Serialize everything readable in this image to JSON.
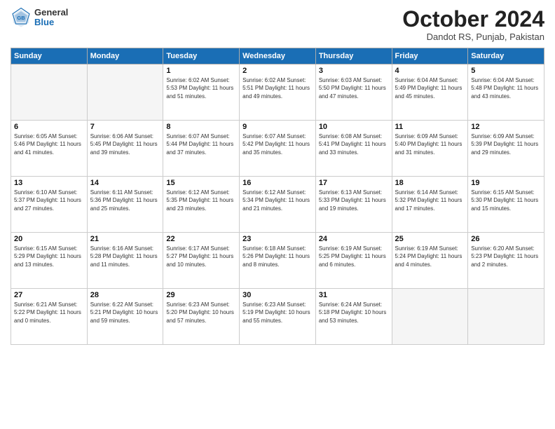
{
  "header": {
    "logo_general": "General",
    "logo_blue": "Blue",
    "month_title": "October 2024",
    "location": "Dandot RS, Punjab, Pakistan"
  },
  "days_of_week": [
    "Sunday",
    "Monday",
    "Tuesday",
    "Wednesday",
    "Thursday",
    "Friday",
    "Saturday"
  ],
  "weeks": [
    [
      {
        "day": "",
        "info": ""
      },
      {
        "day": "",
        "info": ""
      },
      {
        "day": "1",
        "info": "Sunrise: 6:02 AM\nSunset: 5:53 PM\nDaylight: 11 hours and 51 minutes."
      },
      {
        "day": "2",
        "info": "Sunrise: 6:02 AM\nSunset: 5:51 PM\nDaylight: 11 hours and 49 minutes."
      },
      {
        "day": "3",
        "info": "Sunrise: 6:03 AM\nSunset: 5:50 PM\nDaylight: 11 hours and 47 minutes."
      },
      {
        "day": "4",
        "info": "Sunrise: 6:04 AM\nSunset: 5:49 PM\nDaylight: 11 hours and 45 minutes."
      },
      {
        "day": "5",
        "info": "Sunrise: 6:04 AM\nSunset: 5:48 PM\nDaylight: 11 hours and 43 minutes."
      }
    ],
    [
      {
        "day": "6",
        "info": "Sunrise: 6:05 AM\nSunset: 5:46 PM\nDaylight: 11 hours and 41 minutes."
      },
      {
        "day": "7",
        "info": "Sunrise: 6:06 AM\nSunset: 5:45 PM\nDaylight: 11 hours and 39 minutes."
      },
      {
        "day": "8",
        "info": "Sunrise: 6:07 AM\nSunset: 5:44 PM\nDaylight: 11 hours and 37 minutes."
      },
      {
        "day": "9",
        "info": "Sunrise: 6:07 AM\nSunset: 5:42 PM\nDaylight: 11 hours and 35 minutes."
      },
      {
        "day": "10",
        "info": "Sunrise: 6:08 AM\nSunset: 5:41 PM\nDaylight: 11 hours and 33 minutes."
      },
      {
        "day": "11",
        "info": "Sunrise: 6:09 AM\nSunset: 5:40 PM\nDaylight: 11 hours and 31 minutes."
      },
      {
        "day": "12",
        "info": "Sunrise: 6:09 AM\nSunset: 5:39 PM\nDaylight: 11 hours and 29 minutes."
      }
    ],
    [
      {
        "day": "13",
        "info": "Sunrise: 6:10 AM\nSunset: 5:37 PM\nDaylight: 11 hours and 27 minutes."
      },
      {
        "day": "14",
        "info": "Sunrise: 6:11 AM\nSunset: 5:36 PM\nDaylight: 11 hours and 25 minutes."
      },
      {
        "day": "15",
        "info": "Sunrise: 6:12 AM\nSunset: 5:35 PM\nDaylight: 11 hours and 23 minutes."
      },
      {
        "day": "16",
        "info": "Sunrise: 6:12 AM\nSunset: 5:34 PM\nDaylight: 11 hours and 21 minutes."
      },
      {
        "day": "17",
        "info": "Sunrise: 6:13 AM\nSunset: 5:33 PM\nDaylight: 11 hours and 19 minutes."
      },
      {
        "day": "18",
        "info": "Sunrise: 6:14 AM\nSunset: 5:32 PM\nDaylight: 11 hours and 17 minutes."
      },
      {
        "day": "19",
        "info": "Sunrise: 6:15 AM\nSunset: 5:30 PM\nDaylight: 11 hours and 15 minutes."
      }
    ],
    [
      {
        "day": "20",
        "info": "Sunrise: 6:15 AM\nSunset: 5:29 PM\nDaylight: 11 hours and 13 minutes."
      },
      {
        "day": "21",
        "info": "Sunrise: 6:16 AM\nSunset: 5:28 PM\nDaylight: 11 hours and 11 minutes."
      },
      {
        "day": "22",
        "info": "Sunrise: 6:17 AM\nSunset: 5:27 PM\nDaylight: 11 hours and 10 minutes."
      },
      {
        "day": "23",
        "info": "Sunrise: 6:18 AM\nSunset: 5:26 PM\nDaylight: 11 hours and 8 minutes."
      },
      {
        "day": "24",
        "info": "Sunrise: 6:19 AM\nSunset: 5:25 PM\nDaylight: 11 hours and 6 minutes."
      },
      {
        "day": "25",
        "info": "Sunrise: 6:19 AM\nSunset: 5:24 PM\nDaylight: 11 hours and 4 minutes."
      },
      {
        "day": "26",
        "info": "Sunrise: 6:20 AM\nSunset: 5:23 PM\nDaylight: 11 hours and 2 minutes."
      }
    ],
    [
      {
        "day": "27",
        "info": "Sunrise: 6:21 AM\nSunset: 5:22 PM\nDaylight: 11 hours and 0 minutes."
      },
      {
        "day": "28",
        "info": "Sunrise: 6:22 AM\nSunset: 5:21 PM\nDaylight: 10 hours and 59 minutes."
      },
      {
        "day": "29",
        "info": "Sunrise: 6:23 AM\nSunset: 5:20 PM\nDaylight: 10 hours and 57 minutes."
      },
      {
        "day": "30",
        "info": "Sunrise: 6:23 AM\nSunset: 5:19 PM\nDaylight: 10 hours and 55 minutes."
      },
      {
        "day": "31",
        "info": "Sunrise: 6:24 AM\nSunset: 5:18 PM\nDaylight: 10 hours and 53 minutes."
      },
      {
        "day": "",
        "info": ""
      },
      {
        "day": "",
        "info": ""
      }
    ]
  ]
}
